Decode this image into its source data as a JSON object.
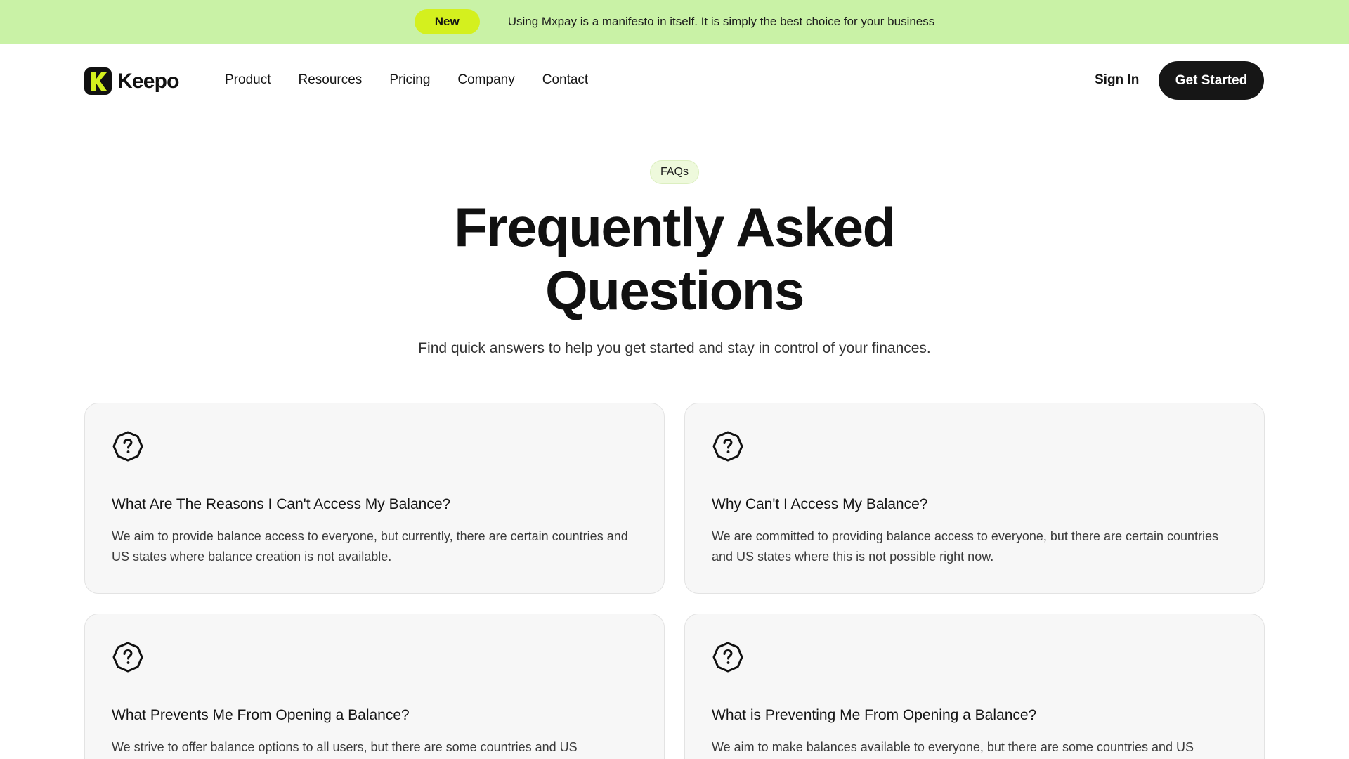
{
  "announcement": {
    "badge": "New",
    "message": "Using Mxpay is a manifesto in itself. It is simply the best choice for your business"
  },
  "nav": {
    "brand": "Keepo",
    "items": [
      {
        "label": "Product"
      },
      {
        "label": "Resources"
      },
      {
        "label": "Pricing"
      },
      {
        "label": "Company"
      },
      {
        "label": "Contact"
      }
    ],
    "sign_in": "Sign In",
    "get_started": "Get Started"
  },
  "hero": {
    "tag": "FAQs",
    "title_line1": "Frequently Asked",
    "title_line2": "Questions",
    "subtitle": "Find quick answers to help you get started and stay in control of your finances."
  },
  "faqs": [
    {
      "icon": "question-octagon-icon",
      "question": "What Are The Reasons I Can't Access My Balance?",
      "answer": "We aim to provide balance access to everyone, but currently, there are certain countries and US states where balance creation is not available."
    },
    {
      "icon": "question-octagon-icon",
      "question": "Why Can't I Access My Balance?",
      "answer": "We are committed to providing balance access to everyone, but there are certain countries and US states where this is not possible right now."
    },
    {
      "icon": "question-octagon-icon",
      "question": "What Prevents Me From Opening a Balance?",
      "answer": "We strive to offer balance options to all users, but there are some countries and US"
    },
    {
      "icon": "question-octagon-icon",
      "question": "What is Preventing Me From Opening a Balance?",
      "answer": "We aim to make balances available to everyone, but there are some countries and US"
    }
  ],
  "colors": {
    "announcement_bg": "#c9f2a6",
    "accent_lime": "#d4f01e",
    "dark": "#161616",
    "card_bg": "#f7f7f7"
  }
}
